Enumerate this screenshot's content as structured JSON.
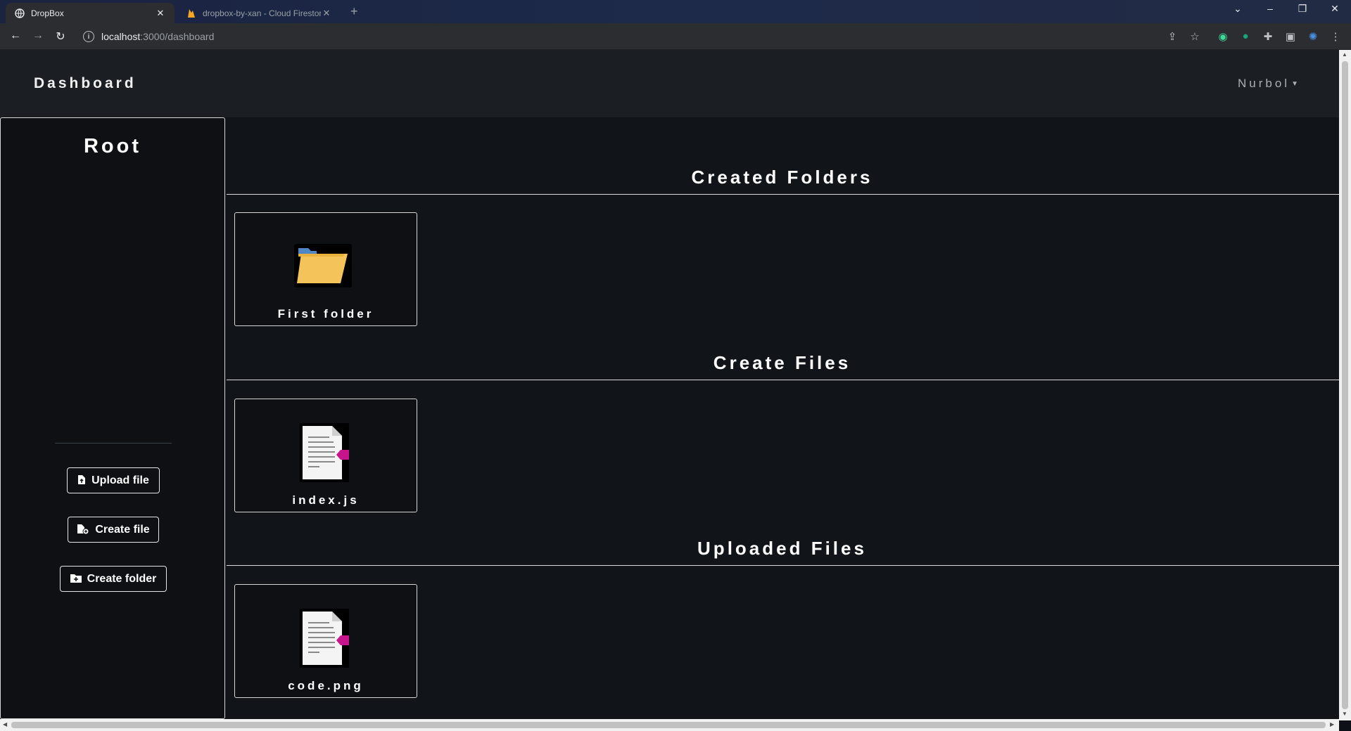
{
  "browser": {
    "tabs": [
      {
        "title": "DropBox",
        "icon": "globe-icon"
      },
      {
        "title": "dropbox-by-xan - Cloud Firestor",
        "icon": "firebase-icon"
      }
    ],
    "url_host": "localhost",
    "url_path": ":3000/dashboard"
  },
  "navbar": {
    "brand": "Dashboard",
    "user": "Nurbol"
  },
  "sidebar": {
    "title": "Root",
    "buttons": {
      "upload": "Upload file",
      "create_file": "Create file",
      "create_folder": "Create folder"
    }
  },
  "sections": {
    "folders": {
      "title": "Created Folders",
      "items": [
        "First folder"
      ]
    },
    "created_files": {
      "title": "Create Files",
      "items": [
        "index.js"
      ]
    },
    "uploaded_files": {
      "title": "Uploaded Files",
      "items": [
        "code.png"
      ]
    }
  },
  "colors": {
    "background": "#111418",
    "navbar": "#1b1e22",
    "folder": "#f4c45a",
    "file_tag": "#c8148c"
  }
}
